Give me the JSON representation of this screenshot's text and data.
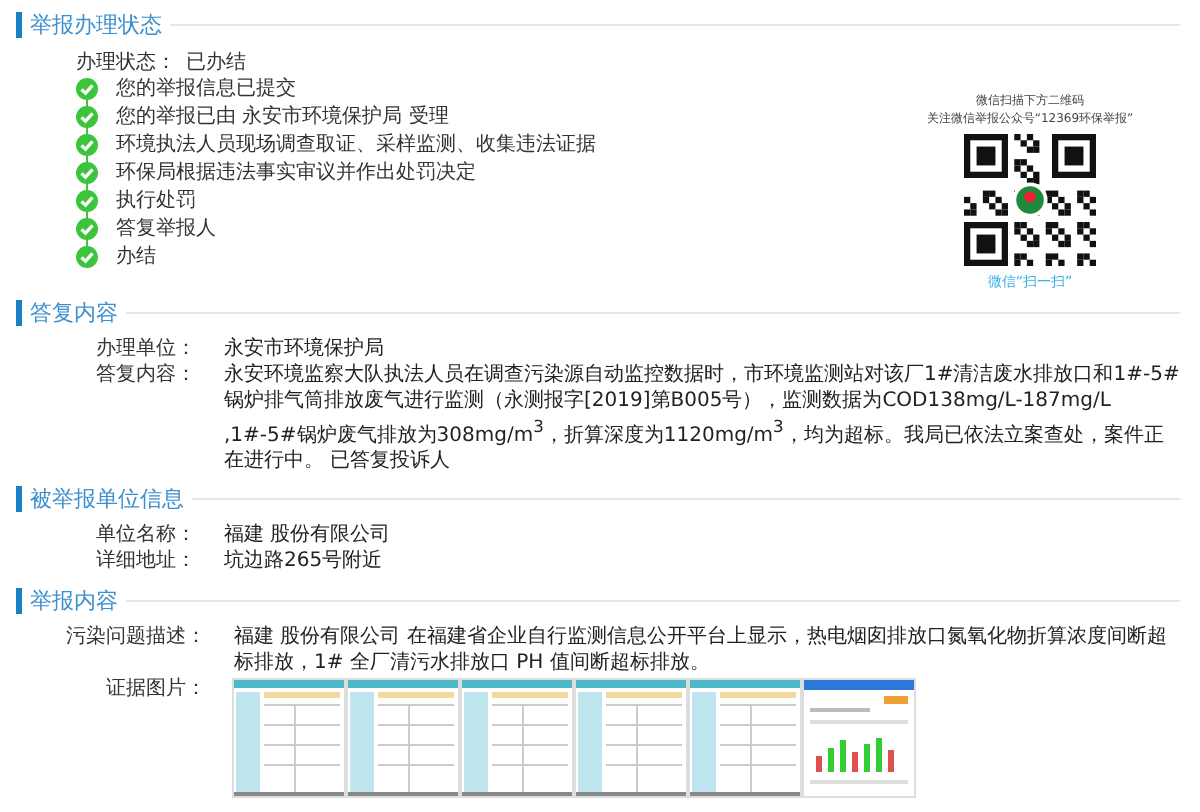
{
  "status_section": {
    "title": "举报办理状态",
    "status_label": "办理状态：",
    "status_value": "已办结",
    "steps": [
      {
        "text": "您的举报信息已提交",
        "done": true
      },
      {
        "text": "您的举报已由 永安市环境保护局 受理",
        "done": true
      },
      {
        "text": "环境执法人员现场调查取证、采样监测、收集违法证据",
        "done": true
      },
      {
        "text": "环保局根据违法事实审议并作出处罚决定",
        "done": true
      },
      {
        "text": "执行处罚",
        "done": true
      },
      {
        "text": "答复举报人",
        "done": true
      },
      {
        "text": "办结",
        "done": true
      }
    ],
    "qr": {
      "line1": "微信扫描下方二维码",
      "line2": "关注微信举报公众号“12369环保举报”",
      "caption": "微信“扫一扫”"
    }
  },
  "reply_section": {
    "title": "答复内容",
    "fields": [
      {
        "label": "办理单位：",
        "value": "永安市环境保护局"
      },
      {
        "label": "答复内容：",
        "value": "永安环境监察大队执法人员在调查污染源自动监控数据时，市环境监测站对该厂1#清洁废水排放口和1#-5#锅炉排气筒排放废气进行监测（永测报字[2019]第B005号），监测数据为COD138mg/L-187mg/L ,1#-5#锅炉废气排放为308mg/m$^{3}$，折算深度为1120mg/m$^{3}$，均为超标。我局已依法立案查处，案件正在进行中。 已答复投诉人"
      }
    ]
  },
  "unit_section": {
    "title": "被举报单位信息",
    "fields": [
      {
        "label": "单位名称：",
        "value": "福建 股份有限公司"
      },
      {
        "label": "详细地址：",
        "value": "坑边路265号附近"
      }
    ]
  },
  "report_section": {
    "title": "举报内容",
    "description_label": "污染问题描述：",
    "description": "福建 股份有限公司 在福建省企业自行监测信息公开平台上显示，热电烟囱排放口氮氧化物折算浓度间断超标排放，1# 全厂清污水排放口 PH 值间断超标排放。",
    "images_label": "证据图片：",
    "images": [
      {
        "kind": "table"
      },
      {
        "kind": "table"
      },
      {
        "kind": "table"
      },
      {
        "kind": "table"
      },
      {
        "kind": "table"
      },
      {
        "kind": "chart"
      }
    ]
  }
}
